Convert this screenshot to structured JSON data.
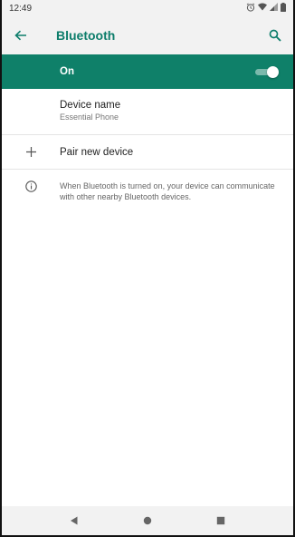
{
  "status_bar": {
    "time": "12:49",
    "icons": [
      "alarm-icon",
      "wifi-icon",
      "signal-icon",
      "battery-icon"
    ]
  },
  "app_bar": {
    "title": "Bluetooth",
    "back_icon": "arrow-back-icon",
    "search_icon": "search-icon"
  },
  "bluetooth_toggle": {
    "label": "On",
    "state": true
  },
  "device_name": {
    "label": "Device name",
    "value": "Essential Phone"
  },
  "pair_new_device": {
    "label": "Pair new device",
    "icon": "plus-icon"
  },
  "info": {
    "icon": "info-icon",
    "text": "When Bluetooth is turned on, your device can communicate with other nearby Bluetooth devices."
  },
  "nav_bar": {
    "buttons": [
      "back-icon",
      "home-icon",
      "recents-icon"
    ]
  },
  "colors": {
    "accent": "#0f8069",
    "title": "#0d7d6b",
    "bar_bg": "#f2f2f2"
  }
}
